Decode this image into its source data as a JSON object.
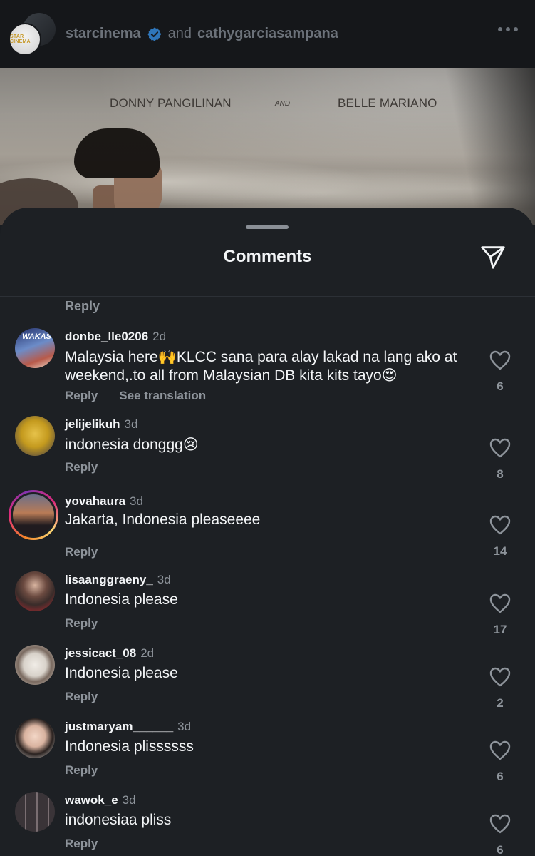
{
  "post_header": {
    "account_logo_text": "STAR CINEMA",
    "author_1": "starcinema",
    "connector": "and",
    "author_2": "cathygarciasampana",
    "more_icon": "more-horizontal-icon",
    "verified_icon": "verified-badge-icon",
    "verified_color": "#3897f0"
  },
  "post_media": {
    "credit_left": "DONNY PANGILINAN",
    "credit_and": "AND",
    "credit_right": "BELLE MARIANO"
  },
  "comments_sheet": {
    "title": "Comments",
    "share_icon": "send-icon",
    "top_reply_label": "Reply",
    "comments": [
      {
        "username": "donbe_lle0206",
        "time": "2d",
        "text": "Malaysia here🙌KLCC sana para alay lakad na lang ako at weekend,.to all from Malaysian DB kita kits tayo😍",
        "reply_label": "Reply",
        "translation_label": "See translation",
        "likes": "6",
        "avatar_text": "WAKAS"
      },
      {
        "username": "jelijelikuh",
        "time": "3d",
        "text": "indonesia donggg😢",
        "reply_label": "Reply",
        "likes": "8"
      },
      {
        "username": "yovahaura",
        "time": "3d",
        "text": "Jakarta, Indonesia pleaseeee",
        "reply_label": "Reply",
        "likes": "14"
      },
      {
        "username": "lisaanggraeny_",
        "time": "3d",
        "text": "Indonesia please",
        "reply_label": "Reply",
        "likes": "17"
      },
      {
        "username": "jessicact_08",
        "time": "2d",
        "text": "Indonesia please",
        "reply_label": "Reply",
        "likes": "2"
      },
      {
        "username": "justmaryam______",
        "time": "3d",
        "text": "Indonesia plissssss",
        "reply_label": "Reply",
        "likes": "6"
      },
      {
        "username": "wawok_e",
        "time": "3d",
        "text": "indonesiaa pliss",
        "reply_label": "Reply",
        "likes": "6"
      }
    ]
  },
  "colors": {
    "background": "#1d2024",
    "header_bg": "#15171a",
    "primary_text": "#f3f5f7",
    "secondary_text": "#8e949b"
  }
}
